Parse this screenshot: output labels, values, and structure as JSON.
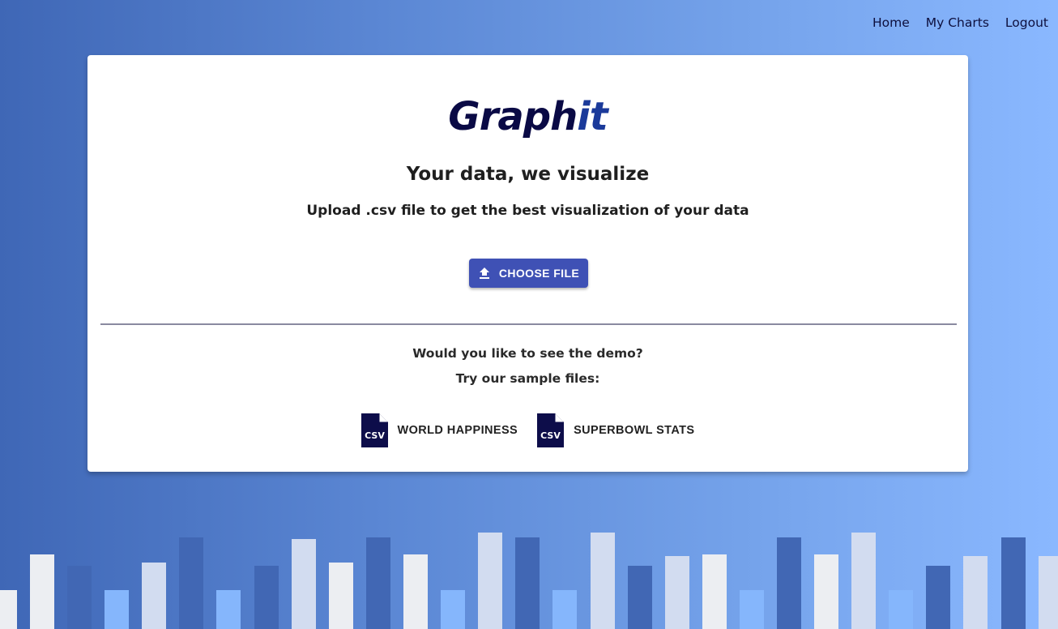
{
  "nav": {
    "home": "Home",
    "my_charts": "My Charts",
    "logout": "Logout"
  },
  "brand": {
    "part1": "Graph",
    "part2": "it",
    "color_part1": "#0a0a45",
    "color_part2": "#1b3a9a"
  },
  "hero": {
    "tagline": "Your data, we visualize",
    "subtitle": "Upload .csv file to get the best visualization of your data"
  },
  "upload": {
    "button_label": "CHOOSE FILE",
    "icon": "upload-icon",
    "color": "#3f51b5"
  },
  "demo": {
    "question": "Would you like to see the demo?",
    "prompt": "Try our sample files:",
    "samples": [
      {
        "label": "WORLD HAPPINESS",
        "icon": "csv-file-icon",
        "icon_text": "CSV"
      },
      {
        "label": "SUPERBOWL STATS",
        "icon": "csv-file-icon",
        "icon_text": "CSV"
      }
    ]
  },
  "colors": {
    "bar_white": "#eceef2",
    "bar_pale": "#d2dcf0",
    "bar_dark": "#4167b4",
    "bar_light": "#85b6fc"
  }
}
